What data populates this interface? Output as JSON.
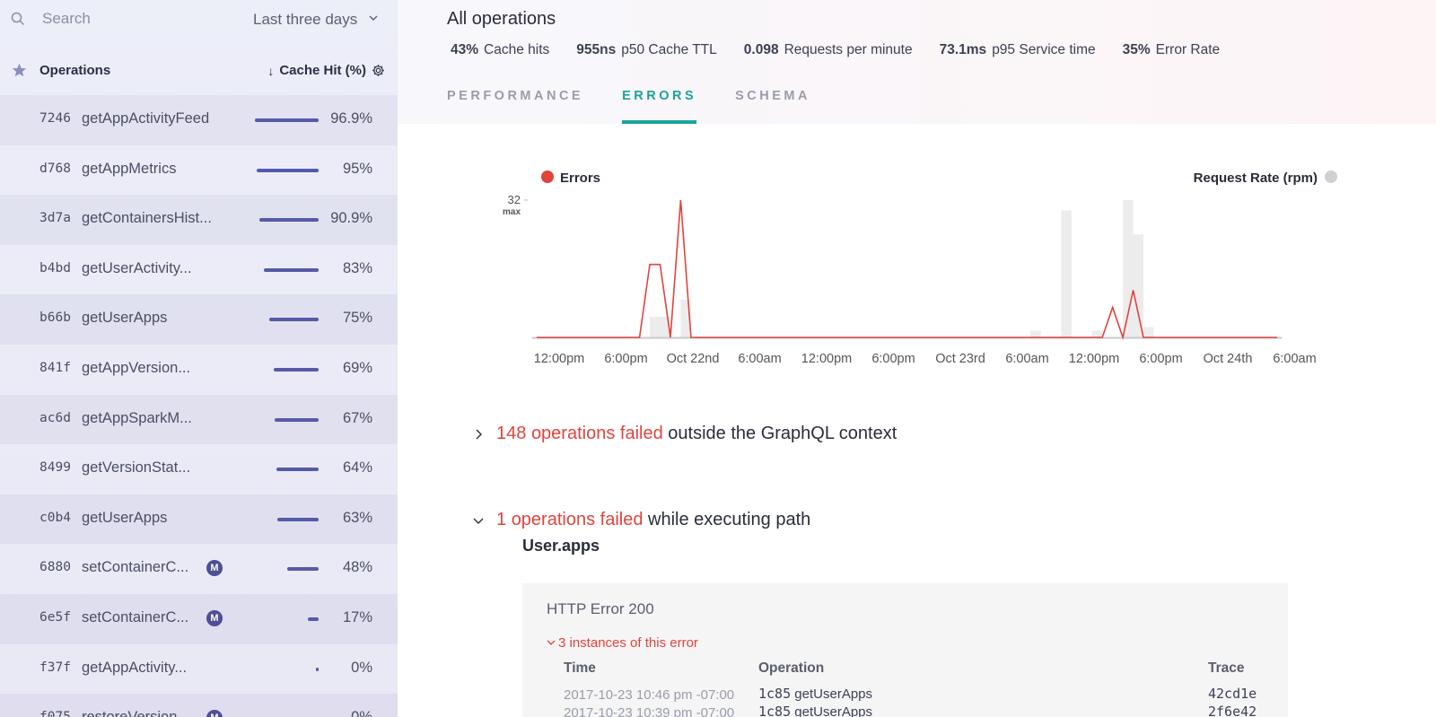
{
  "sidebar": {
    "search_placeholder": "Search",
    "time_range": "Last three days",
    "header_title": "Operations",
    "sort_label": "Cache Hit (%)",
    "sort_arrow": "↓",
    "operations": [
      {
        "hash": "7246",
        "name": "getAppActivityFeed",
        "pct": "96.9%",
        "fill": 0.969,
        "badge": ""
      },
      {
        "hash": "d768",
        "name": "getAppMetrics",
        "pct": "95%",
        "fill": 0.95,
        "badge": ""
      },
      {
        "hash": "3d7a",
        "name": "getContainersHist...",
        "pct": "90.9%",
        "fill": 0.909,
        "badge": ""
      },
      {
        "hash": "b4bd",
        "name": "getUserActivity...",
        "pct": "83%",
        "fill": 0.83,
        "badge": ""
      },
      {
        "hash": "b66b",
        "name": "getUserApps",
        "pct": "75%",
        "fill": 0.75,
        "badge": ""
      },
      {
        "hash": "841f",
        "name": "getAppVersion...",
        "pct": "69%",
        "fill": 0.69,
        "badge": ""
      },
      {
        "hash": "ac6d",
        "name": "getAppSparkM...",
        "pct": "67%",
        "fill": 0.67,
        "badge": ""
      },
      {
        "hash": "8499",
        "name": "getVersionStat...",
        "pct": "64%",
        "fill": 0.64,
        "badge": ""
      },
      {
        "hash": "c0b4",
        "name": "getUserApps",
        "pct": "63%",
        "fill": 0.63,
        "badge": ""
      },
      {
        "hash": "6880",
        "name": "setContainerC...",
        "pct": "48%",
        "fill": 0.48,
        "badge": "M"
      },
      {
        "hash": "6e5f",
        "name": "setContainerC...",
        "pct": "17%",
        "fill": 0.17,
        "badge": "M"
      },
      {
        "hash": "f37f",
        "name": "getAppActivity...",
        "pct": "0%",
        "fill": 0.0,
        "badge": ""
      },
      {
        "hash": "f075",
        "name": "restoreVersion...",
        "pct": "0%",
        "fill": 0.0,
        "badge": "M"
      }
    ]
  },
  "main": {
    "title": "All operations",
    "stats": [
      {
        "value": "43%",
        "label": "Cache hits"
      },
      {
        "value": "955ns",
        "label": "p50 Cache TTL"
      },
      {
        "value": "0.098",
        "label": "Requests per minute"
      },
      {
        "value": "73.1ms",
        "label": "p95 Service time"
      },
      {
        "value": "35%",
        "label": "Error Rate"
      }
    ],
    "tabs": [
      {
        "label": "PERFORMANCE",
        "active": false
      },
      {
        "label": "ERRORS",
        "active": true
      },
      {
        "label": "SCHEMA",
        "active": false
      }
    ]
  },
  "chart_data": {
    "type": "line",
    "legend": [
      {
        "label": "Errors",
        "color": "#e0443c"
      },
      {
        "label": "Request Rate (rpm)",
        "color": "#cfcfd4"
      }
    ],
    "left_axis": {
      "max_value": "32",
      "max_label": "max"
    },
    "right_axis": {
      "max_value": "2",
      "max_label": "max"
    },
    "x_tick_labels": [
      "12:00pm",
      "6:00pm",
      "Oct 22nd",
      "6:00am",
      "12:00pm",
      "6:00pm",
      "Oct 23rd",
      "6:00am",
      "12:00pm",
      "6:00pm",
      "Oct 24th",
      "6:00am"
    ],
    "series": [
      {
        "name": "Errors",
        "x": [
          0,
          2,
          4,
          6,
          8,
          10,
          11,
          12,
          13,
          14,
          15,
          16,
          17,
          18,
          20,
          30,
          40,
          50,
          54,
          55,
          56,
          57,
          58,
          59,
          60,
          62,
          64,
          66,
          72
        ],
        "values": [
          0,
          0,
          0,
          0,
          0,
          0,
          17,
          17,
          0,
          32,
          0,
          0,
          0,
          0,
          0,
          0,
          0,
          0,
          0,
          0,
          7,
          0,
          11,
          0,
          0,
          0,
          0,
          0,
          0
        ]
      },
      {
        "name": "Request Rate (rpm)",
        "x": [
          11,
          12,
          13,
          14,
          48,
          51,
          54,
          57,
          58,
          59
        ],
        "values": [
          0.3,
          0.3,
          0,
          0.55,
          0.1,
          1.85,
          0.1,
          2.0,
          1.5,
          0.15
        ]
      }
    ]
  },
  "errors": {
    "group1": {
      "count": "148",
      "red_text": "operations failed",
      "rest": "outside the GraphQL context"
    },
    "group2": {
      "count": "1",
      "red_text": "operations failed",
      "rest": "while executing path"
    },
    "path": "User.apps",
    "error_title": "HTTP Error 200",
    "instances_text": "3 instances of this error",
    "columns": [
      "Time",
      "Operation",
      "Trace"
    ],
    "rows": [
      {
        "time": "2017-10-23 10:46 pm -07:00",
        "op_hash": "1c85",
        "op_name": "getUserApps",
        "trace": "42cd1e"
      },
      {
        "time": "2017-10-23 10:39 pm -07:00",
        "op_hash": "1c85",
        "op_name": "getUserApps",
        "trace": "2f6e42"
      }
    ]
  }
}
